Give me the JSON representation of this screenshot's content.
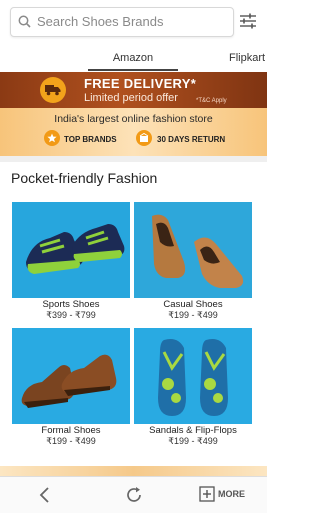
{
  "search": {
    "placeholder": "Search Shoes Brands"
  },
  "tabs": [
    {
      "label": "Amazon",
      "active": true
    },
    {
      "label": "Flipkart",
      "active": false
    }
  ],
  "promo": {
    "title": "FREE DELIVERY*",
    "subtitle": "Limited period offer",
    "terms": "*T&C Apply",
    "tagline": "India's largest online fashion store",
    "badges": [
      "TOP BRANDS",
      "30 DAYS RETURN"
    ]
  },
  "section": {
    "title": "Pocket-friendly Fashion"
  },
  "products": [
    {
      "name": "Sports Shoes",
      "price": "₹399 - ₹799"
    },
    {
      "name": "Casual Shoes",
      "price": "₹199 - ₹499"
    },
    {
      "name": "Formal Shoes",
      "price": "₹199 - ₹499"
    },
    {
      "name": "Sandals & Flip-Flops",
      "price": "₹199 - ₹499"
    }
  ],
  "nav": {
    "more_label": "MORE"
  },
  "colors": {
    "accent": "#f29a16",
    "banner": "#a44a1b",
    "product_bg": "#29aae2"
  }
}
